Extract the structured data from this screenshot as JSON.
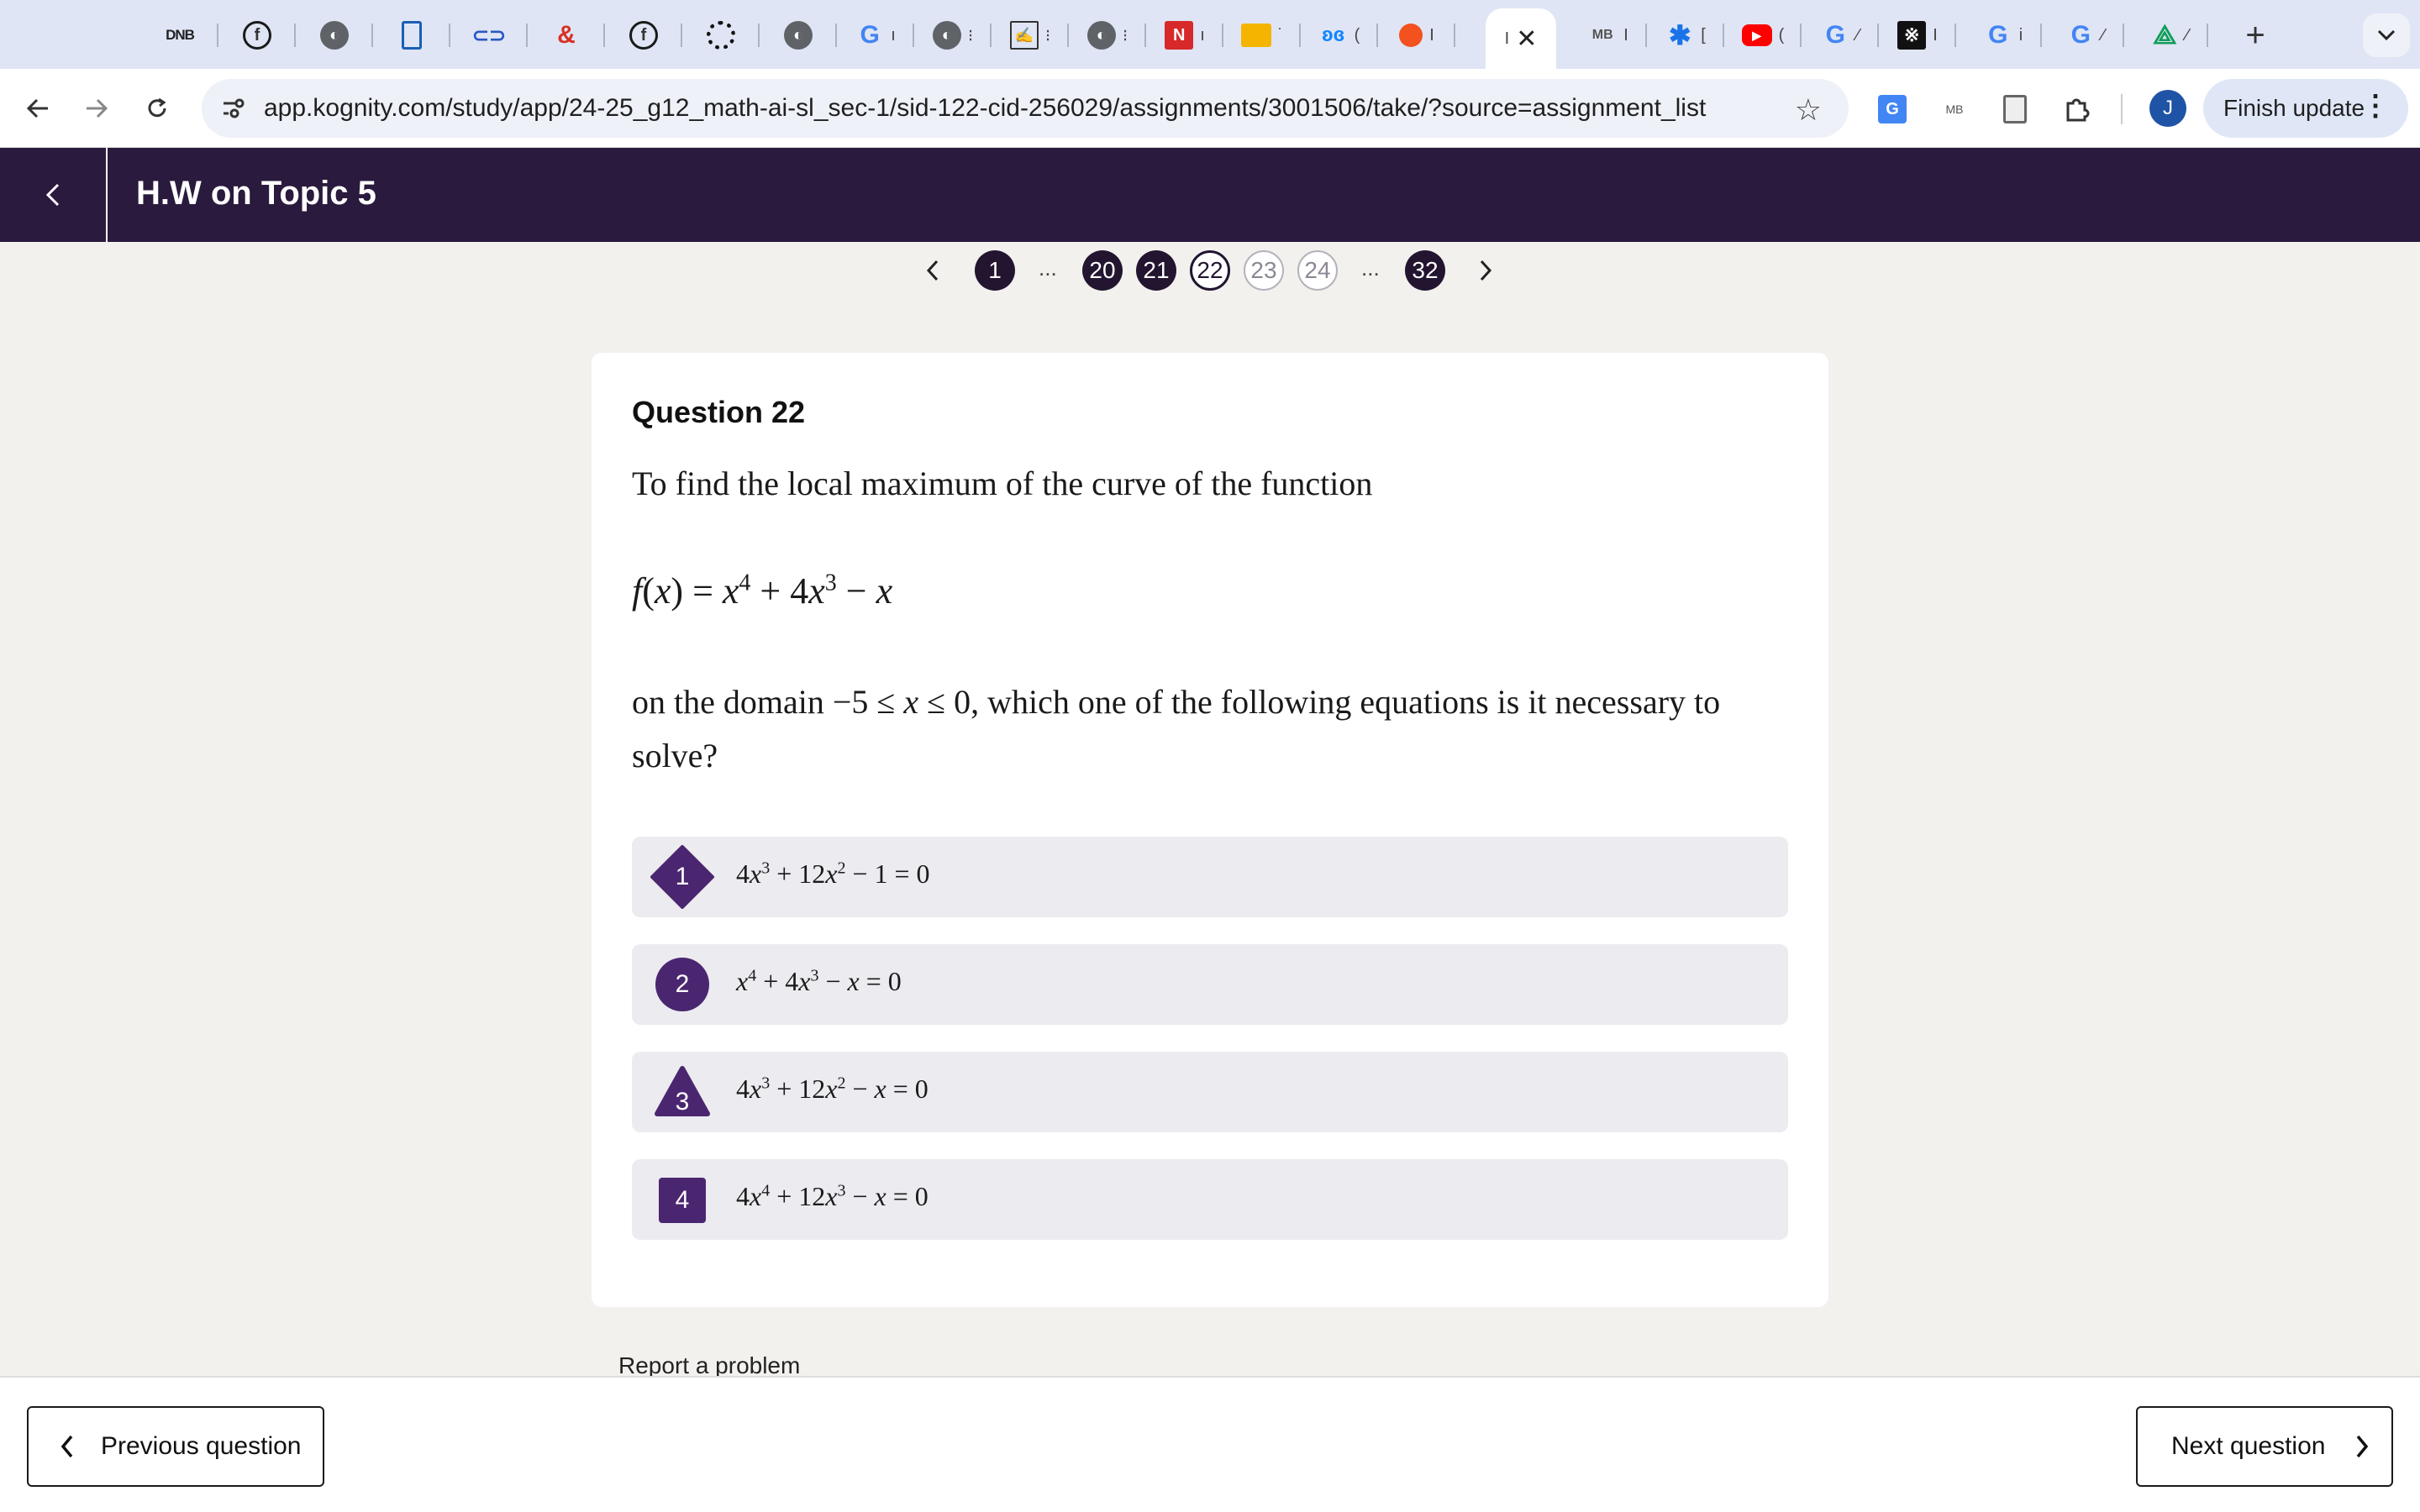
{
  "browser": {
    "tabs": [
      {
        "icon": "dnb-icon",
        "label": "DNB"
      },
      {
        "icon": "fb-logo-icon",
        "label": ""
      },
      {
        "icon": "globe-icon",
        "label": ""
      },
      {
        "icon": "document-icon",
        "label": ""
      },
      {
        "icon": "paperclip-icon",
        "label": ""
      },
      {
        "icon": "ampersand-icon",
        "label": ""
      },
      {
        "icon": "fb-logo-icon",
        "label": ""
      },
      {
        "icon": "sunburst-icon",
        "label": ""
      },
      {
        "icon": "globe-icon",
        "label": ""
      },
      {
        "icon": "google-icon",
        "label": ""
      },
      {
        "icon": "globe-icon",
        "label": ""
      },
      {
        "icon": "scribble-icon",
        "label": ""
      },
      {
        "icon": "globe-icon",
        "label": ""
      },
      {
        "icon": "notion-icon",
        "label": ""
      },
      {
        "icon": "slides-icon",
        "label": ""
      },
      {
        "icon": "butterfly-icon",
        "label": ""
      },
      {
        "icon": "record-icon",
        "label": ""
      },
      {
        "icon": "active-tab-icon",
        "label": ""
      },
      {
        "icon": "mb-icon",
        "label": "MB"
      },
      {
        "icon": "puzzle-icon",
        "label": ""
      },
      {
        "icon": "youtube-icon",
        "label": ""
      },
      {
        "icon": "google-icon",
        "label": ""
      },
      {
        "icon": "kanji-icon",
        "label": ""
      },
      {
        "icon": "google-icon",
        "label": ""
      },
      {
        "icon": "google-icon",
        "label": ""
      },
      {
        "icon": "drive-icon",
        "label": ""
      }
    ],
    "url": "app.kognity.com/study/app/24-25_g12_math-ai-sl_sec-1/sid-122-cid-256029/assignments/3001506/take/?source=assignment_list",
    "avatar_initial": "J",
    "finish_update_label": "Finish update",
    "mb_label": "MB",
    "accent": "#1f53a6"
  },
  "header": {
    "title": "H.W on Topic 5"
  },
  "pager": {
    "pages": [
      "1",
      "20",
      "21",
      "22",
      "23",
      "24",
      "32"
    ],
    "current": "22",
    "ellipsis": "..."
  },
  "question": {
    "title": "Question 22",
    "intro": "To find the local maximum of the curve of the function",
    "domain_prefix": "on the domain",
    "domain_suffix": ", which one of the following equations is it necessary to",
    "closing": "solve?",
    "options": [
      {
        "number": "1",
        "shape": "diamond"
      },
      {
        "number": "2",
        "shape": "circle"
      },
      {
        "number": "3",
        "shape": "triangle"
      },
      {
        "number": "4",
        "shape": "square"
      }
    ],
    "badge_color": "#4b2670"
  },
  "report_label": "Report a problem",
  "footer": {
    "previous_label": "Previous question",
    "next_label": "Next question"
  }
}
